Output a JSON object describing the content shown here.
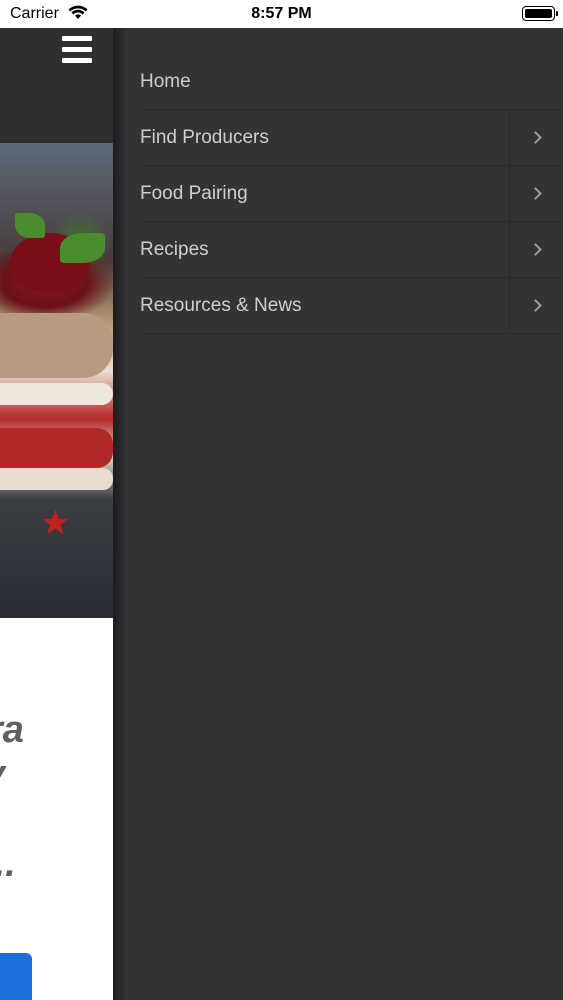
{
  "status_bar": {
    "carrier": "Carrier",
    "time": "8:57 PM",
    "icons": [
      "wifi-icon",
      "battery-icon"
    ]
  },
  "main": {
    "teaser_lines": [
      "ra",
      "y",
      "..."
    ]
  },
  "menu": {
    "items": [
      {
        "label": "Home",
        "has_submenu": false
      },
      {
        "label": "Find Producers",
        "has_submenu": true
      },
      {
        "label": "Food Pairing",
        "has_submenu": true
      },
      {
        "label": "Recipes",
        "has_submenu": true
      },
      {
        "label": "Resources & News",
        "has_submenu": true
      }
    ]
  },
  "colors": {
    "drawer_bg": "#333235",
    "menu_text": "#cfcfcf",
    "accent_button": "#1e6fd9"
  }
}
